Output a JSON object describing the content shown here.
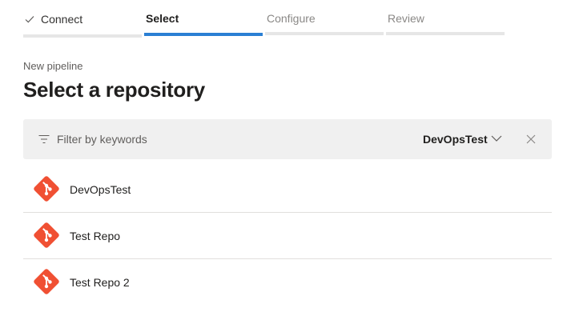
{
  "wizard": {
    "steps": [
      {
        "label": "Connect",
        "state": "done"
      },
      {
        "label": "Select",
        "state": "active"
      },
      {
        "label": "Configure",
        "state": "pending"
      },
      {
        "label": "Review",
        "state": "pending"
      }
    ]
  },
  "header": {
    "subtitle": "New pipeline",
    "title": "Select a repository"
  },
  "filter": {
    "placeholder": "Filter by keywords",
    "value": "",
    "organization": "DevOpsTest",
    "icon": "filter-icon",
    "dropdown_icon": "chevron-down-icon",
    "clear_icon": "close-icon"
  },
  "repositories": [
    {
      "name": "DevOpsTest",
      "icon": "git-icon"
    },
    {
      "name": "Test Repo",
      "icon": "git-icon"
    },
    {
      "name": "Test Repo 2",
      "icon": "git-icon"
    }
  ],
  "colors": {
    "accent": "#2b7fd4",
    "git": "#f05033",
    "filter_bg": "#f0f0f0"
  }
}
